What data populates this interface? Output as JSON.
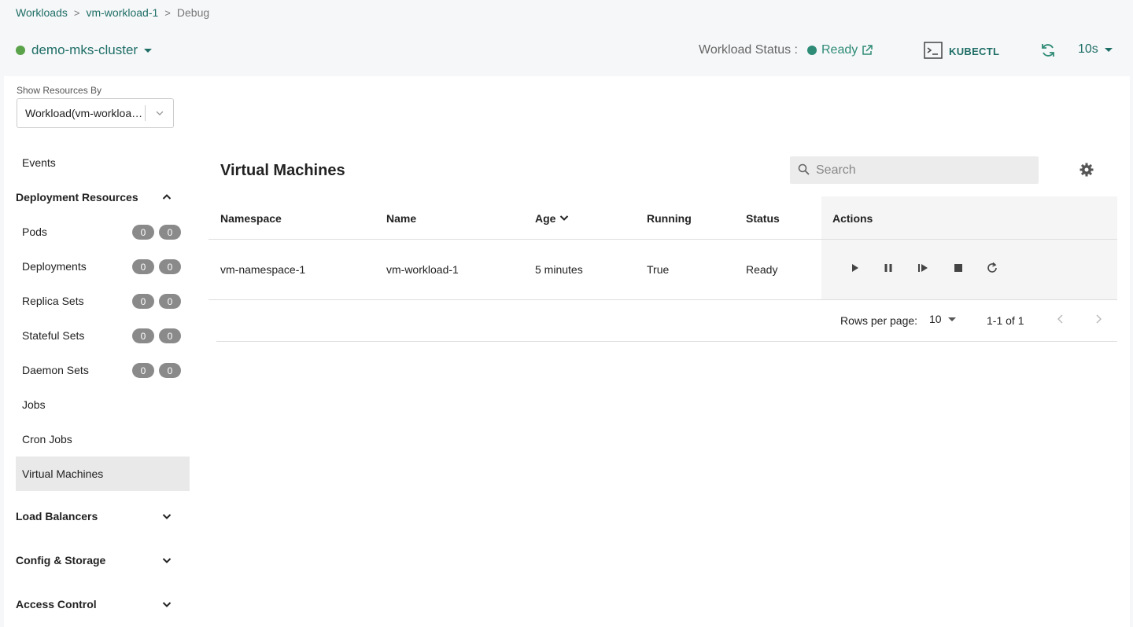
{
  "breadcrumb": {
    "items": [
      "Workloads",
      "vm-workload-1"
    ],
    "current": "Debug",
    "separator": ">"
  },
  "cluster": {
    "name": "demo-mks-cluster",
    "status_color": "#5aa34a"
  },
  "workload_status": {
    "label": "Workload Status :",
    "value": "Ready",
    "color": "#2e8b76"
  },
  "kubectl": {
    "label": "KUBECTL"
  },
  "refresh": {
    "interval": "10s"
  },
  "show_resources": {
    "label": "Show Resources By",
    "value": "Workload(vm-workload-1)"
  },
  "sidebar": {
    "events": "Events",
    "deployment_resources": {
      "label": "Deployment Resources",
      "items": [
        {
          "label": "Pods",
          "badges": [
            "0",
            "0"
          ]
        },
        {
          "label": "Deployments",
          "badges": [
            "0",
            "0"
          ]
        },
        {
          "label": "Replica Sets",
          "badges": [
            "0",
            "0"
          ]
        },
        {
          "label": "Stateful Sets",
          "badges": [
            "0",
            "0"
          ]
        },
        {
          "label": "Daemon Sets",
          "badges": [
            "0",
            "0"
          ]
        },
        {
          "label": "Jobs"
        },
        {
          "label": "Cron Jobs"
        },
        {
          "label": "Virtual Machines",
          "active": true
        }
      ]
    },
    "groups": [
      "Load Balancers",
      "Config & Storage",
      "Access Control"
    ]
  },
  "main": {
    "title": "Virtual Machines",
    "search": {
      "placeholder": "Search"
    },
    "table": {
      "columns": [
        "Namespace",
        "Name",
        "Age",
        "Running",
        "Status",
        "Actions"
      ],
      "rows": [
        {
          "namespace": "vm-namespace-1",
          "name": "vm-workload-1",
          "age": "5 minutes",
          "running": "True",
          "status": "Ready"
        }
      ],
      "actions": [
        "play-icon",
        "pause-icon",
        "step-forward-icon",
        "stop-icon",
        "restart-icon"
      ]
    },
    "pagination": {
      "rows_per_page_label": "Rows per page:",
      "rows_per_page": "10",
      "range": "1-1 of 1"
    }
  },
  "colors": {
    "accent": "#1e6e66",
    "ready": "#2e8b76",
    "badge": "#8a8a8a",
    "active_bg": "#e9e9e9"
  }
}
